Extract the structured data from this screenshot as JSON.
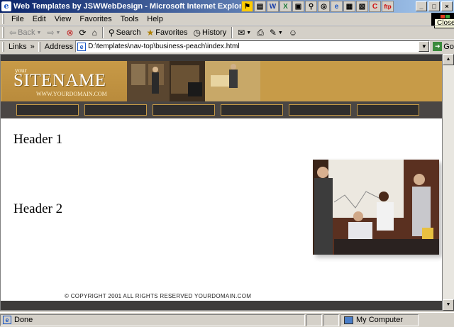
{
  "window": {
    "title": "Web Templates by JSWWebDesign - Microsoft Internet Explorer",
    "app_icon": "ie-icon",
    "tray_icons": [
      "flag-icon",
      "folder-icon",
      "word-icon",
      "excel-icon",
      "app-icon",
      "search-icon",
      "magnify-icon",
      "ie-icon",
      "app-icon",
      "app-icon",
      "c-icon",
      "ftp-icon"
    ],
    "controls": {
      "minimize": "_",
      "maximize": "□",
      "close": "×"
    },
    "close_tooltip": "Close"
  },
  "menu": {
    "items": [
      {
        "label": "File"
      },
      {
        "label": "Edit"
      },
      {
        "label": "View"
      },
      {
        "label": "Favorites"
      },
      {
        "label": "Tools"
      },
      {
        "label": "Help"
      }
    ]
  },
  "toolbar": {
    "back": "Back",
    "search": "Search",
    "favorites": "Favorites",
    "history": "History"
  },
  "address": {
    "links_label": "Links",
    "links_chevron": "»",
    "label": "Address",
    "url": "D:\\templates\\nav-top\\business-peach\\index.html",
    "go_label": "Go"
  },
  "site": {
    "logo_your": "your",
    "logo_name": "SITENAME",
    "logo_domain": "WWW.YOURDOMAIN.COM",
    "nav_items": [
      "",
      "",
      "",
      "",
      "",
      ""
    ],
    "header1": "Header 1",
    "header2": "Header 2",
    "copyright": "© COPYRIGHT 2001 ALL RIGHTS RESERVED YOURDOMAIN.COM",
    "colors": {
      "peach": "#c69a46",
      "dark": "#3d3b3a"
    }
  },
  "status": {
    "text": "Done",
    "zone": "My Computer"
  }
}
